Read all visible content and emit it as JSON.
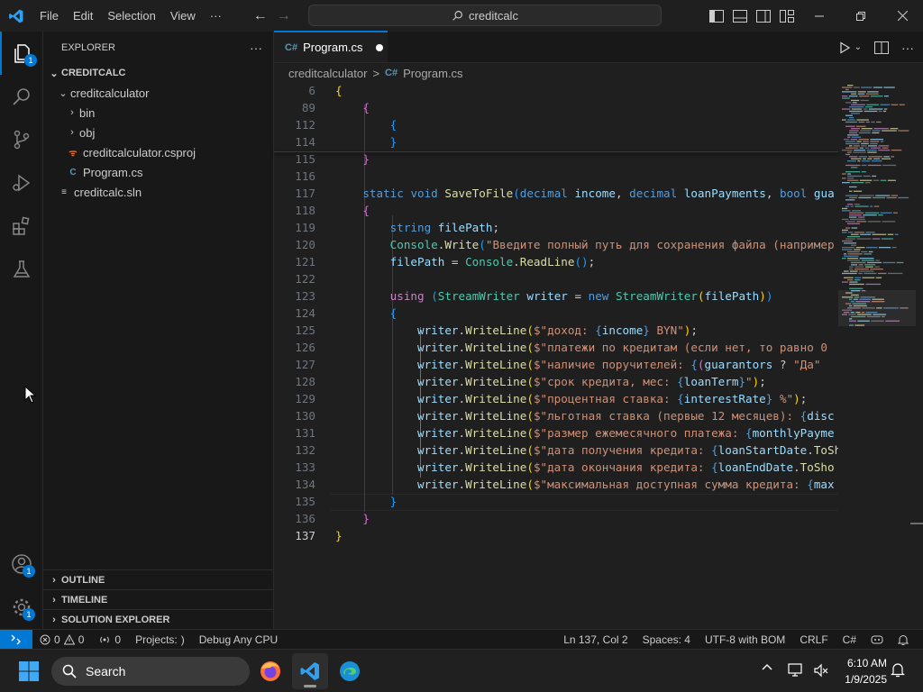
{
  "titlebar": {
    "menu": [
      "File",
      "Edit",
      "Selection",
      "View",
      "···"
    ],
    "search_text": "creditcalc"
  },
  "activity": {
    "explorer_badge": "1",
    "accounts_badge": "1",
    "manage_badge": "1"
  },
  "sidebar": {
    "header": "EXPLORER",
    "more": "···",
    "root": "CREDITCALC",
    "tree": [
      {
        "label": "creditcalculator",
        "kind": "folder-open",
        "depth": 1
      },
      {
        "label": "bin",
        "kind": "folder",
        "depth": 2
      },
      {
        "label": "obj",
        "kind": "folder",
        "depth": 2
      },
      {
        "label": "creditcalculator.csproj",
        "kind": "csproj",
        "depth": 2
      },
      {
        "label": "Program.cs",
        "kind": "cs",
        "depth": 2
      },
      {
        "label": "creditcalc.sln",
        "kind": "sln",
        "depth": 1
      }
    ],
    "panels": [
      "OUTLINE",
      "TIMELINE",
      "SOLUTION EXPLORER"
    ]
  },
  "editor": {
    "tab_label": "Program.cs",
    "tab_icon": "C#",
    "breadcrumb": [
      "creditcalculator",
      "Program.cs"
    ],
    "breadcrumb_sep": ">",
    "lines": [
      {
        "n": "6",
        "t": [
          [
            "b1",
            "{"
          ]
        ]
      },
      {
        "n": "89",
        "t": [
          [
            "pl",
            "    "
          ],
          [
            "b2",
            "{"
          ]
        ]
      },
      {
        "n": "112",
        "t": [
          [
            "pl",
            "        "
          ],
          [
            "b3",
            "{"
          ]
        ]
      },
      {
        "n": "114",
        "t": [
          [
            "pl",
            "        "
          ],
          [
            "b3",
            "}"
          ]
        ]
      },
      {
        "n": "115",
        "t": [
          [
            "pl",
            "    "
          ],
          [
            "b2",
            "}"
          ]
        ]
      },
      {
        "n": "116",
        "t": []
      },
      {
        "n": "117",
        "t": [
          [
            "pl",
            "    "
          ],
          [
            "kw",
            "static"
          ],
          [
            "pl",
            " "
          ],
          [
            "kw",
            "void"
          ],
          [
            "pl",
            " "
          ],
          [
            "fn",
            "SaveToFile"
          ],
          [
            "b3",
            "("
          ],
          [
            "kw",
            "decimal"
          ],
          [
            "pl",
            " "
          ],
          [
            "var",
            "income"
          ],
          [
            "pl",
            ", "
          ],
          [
            "kw",
            "decimal"
          ],
          [
            "pl",
            " "
          ],
          [
            "var",
            "loanPayments"
          ],
          [
            "pl",
            ", "
          ],
          [
            "kw",
            "bool"
          ],
          [
            "pl",
            " "
          ],
          [
            "var",
            "gua"
          ]
        ]
      },
      {
        "n": "118",
        "t": [
          [
            "pl",
            "    "
          ],
          [
            "b2",
            "{"
          ]
        ]
      },
      {
        "n": "119",
        "t": [
          [
            "pl",
            "        "
          ],
          [
            "kw",
            "string"
          ],
          [
            "pl",
            " "
          ],
          [
            "var",
            "filePath"
          ],
          [
            "pl",
            ";"
          ]
        ]
      },
      {
        "n": "120",
        "t": [
          [
            "pl",
            "        "
          ],
          [
            "ty",
            "Console"
          ],
          [
            "pl",
            "."
          ],
          [
            "fn",
            "Write"
          ],
          [
            "b3",
            "("
          ],
          [
            "str",
            "\"Введите полный путь для сохранения файла (например"
          ]
        ]
      },
      {
        "n": "121",
        "t": [
          [
            "pl",
            "        "
          ],
          [
            "var",
            "filePath"
          ],
          [
            "pl",
            " = "
          ],
          [
            "ty",
            "Console"
          ],
          [
            "pl",
            "."
          ],
          [
            "fn",
            "ReadLine"
          ],
          [
            "b3",
            "()"
          ],
          [
            "pl",
            ";"
          ]
        ]
      },
      {
        "n": "122",
        "t": []
      },
      {
        "n": "123",
        "t": [
          [
            "pl",
            "        "
          ],
          [
            "ctl",
            "using"
          ],
          [
            "pl",
            " "
          ],
          [
            "b3",
            "("
          ],
          [
            "ty",
            "StreamWriter"
          ],
          [
            "pl",
            " "
          ],
          [
            "var",
            "writer"
          ],
          [
            "pl",
            " = "
          ],
          [
            "kw",
            "new"
          ],
          [
            "pl",
            " "
          ],
          [
            "ty",
            "StreamWriter"
          ],
          [
            "b1",
            "("
          ],
          [
            "var",
            "filePath"
          ],
          [
            "b1",
            ")"
          ],
          [
            "b3",
            ")"
          ]
        ]
      },
      {
        "n": "124",
        "t": [
          [
            "pl",
            "        "
          ],
          [
            "b3",
            "{"
          ]
        ]
      },
      {
        "n": "125",
        "t": [
          [
            "pl",
            "            "
          ],
          [
            "var",
            "writer"
          ],
          [
            "pl",
            "."
          ],
          [
            "fn",
            "WriteLine"
          ],
          [
            "b1",
            "("
          ],
          [
            "str",
            "$\"доход: "
          ],
          [
            "kw",
            "{"
          ],
          [
            "var",
            "income"
          ],
          [
            "kw",
            "}"
          ],
          [
            "str",
            " BYN\""
          ],
          [
            "b1",
            ")"
          ],
          [
            "pl",
            ";"
          ]
        ]
      },
      {
        "n": "126",
        "t": [
          [
            "pl",
            "            "
          ],
          [
            "var",
            "writer"
          ],
          [
            "pl",
            "."
          ],
          [
            "fn",
            "WriteLine"
          ],
          [
            "b1",
            "("
          ],
          [
            "str",
            "$\"платежи по кредитам (если нет, то равно 0"
          ]
        ]
      },
      {
        "n": "127",
        "t": [
          [
            "pl",
            "            "
          ],
          [
            "var",
            "writer"
          ],
          [
            "pl",
            "."
          ],
          [
            "fn",
            "WriteLine"
          ],
          [
            "b1",
            "("
          ],
          [
            "str",
            "$\"наличие поручителей: "
          ],
          [
            "kw",
            "{"
          ],
          [
            "b2",
            "("
          ],
          [
            "var",
            "guarantors"
          ],
          [
            "pl",
            " ? "
          ],
          [
            "str",
            "\"Да\""
          ]
        ]
      },
      {
        "n": "128",
        "t": [
          [
            "pl",
            "            "
          ],
          [
            "var",
            "writer"
          ],
          [
            "pl",
            "."
          ],
          [
            "fn",
            "WriteLine"
          ],
          [
            "b1",
            "("
          ],
          [
            "str",
            "$\"срок кредита, мес: "
          ],
          [
            "kw",
            "{"
          ],
          [
            "var",
            "loanTerm"
          ],
          [
            "kw",
            "}"
          ],
          [
            "str",
            "\""
          ],
          [
            "b1",
            ")"
          ],
          [
            "pl",
            ";"
          ]
        ]
      },
      {
        "n": "129",
        "t": [
          [
            "pl",
            "            "
          ],
          [
            "var",
            "writer"
          ],
          [
            "pl",
            "."
          ],
          [
            "fn",
            "WriteLine"
          ],
          [
            "b1",
            "("
          ],
          [
            "str",
            "$\"процентная ставка: "
          ],
          [
            "kw",
            "{"
          ],
          [
            "var",
            "interestRate"
          ],
          [
            "kw",
            "}"
          ],
          [
            "str",
            " %\""
          ],
          [
            "b1",
            ")"
          ],
          [
            "pl",
            ";"
          ]
        ]
      },
      {
        "n": "130",
        "t": [
          [
            "pl",
            "            "
          ],
          [
            "var",
            "writer"
          ],
          [
            "pl",
            "."
          ],
          [
            "fn",
            "WriteLine"
          ],
          [
            "b1",
            "("
          ],
          [
            "str",
            "$\"льготная ставка (первые 12 месяцев): "
          ],
          [
            "kw",
            "{"
          ],
          [
            "var",
            "disc"
          ]
        ]
      },
      {
        "n": "131",
        "t": [
          [
            "pl",
            "            "
          ],
          [
            "var",
            "writer"
          ],
          [
            "pl",
            "."
          ],
          [
            "fn",
            "WriteLine"
          ],
          [
            "b1",
            "("
          ],
          [
            "str",
            "$\"размер ежемесячного платежа: "
          ],
          [
            "kw",
            "{"
          ],
          [
            "var",
            "monthlyPayme"
          ]
        ]
      },
      {
        "n": "132",
        "t": [
          [
            "pl",
            "            "
          ],
          [
            "var",
            "writer"
          ],
          [
            "pl",
            "."
          ],
          [
            "fn",
            "WriteLine"
          ],
          [
            "b1",
            "("
          ],
          [
            "str",
            "$\"дата получения кредита: "
          ],
          [
            "kw",
            "{"
          ],
          [
            "var",
            "loanStartDate"
          ],
          [
            "pl",
            "."
          ],
          [
            "fn",
            "ToSh"
          ]
        ]
      },
      {
        "n": "133",
        "t": [
          [
            "pl",
            "            "
          ],
          [
            "var",
            "writer"
          ],
          [
            "pl",
            "."
          ],
          [
            "fn",
            "WriteLine"
          ],
          [
            "b1",
            "("
          ],
          [
            "str",
            "$\"дата окончания кредита: "
          ],
          [
            "kw",
            "{"
          ],
          [
            "var",
            "loanEndDate"
          ],
          [
            "pl",
            "."
          ],
          [
            "fn",
            "ToSho"
          ]
        ]
      },
      {
        "n": "134",
        "t": [
          [
            "pl",
            "            "
          ],
          [
            "var",
            "writer"
          ],
          [
            "pl",
            "."
          ],
          [
            "fn",
            "WriteLine"
          ],
          [
            "b1",
            "("
          ],
          [
            "str",
            "$\"максимальная доступная сумма кредита: "
          ],
          [
            "kw",
            "{"
          ],
          [
            "var",
            "max"
          ]
        ]
      },
      {
        "n": "135",
        "t": [
          [
            "pl",
            "        "
          ],
          [
            "b3",
            "}"
          ]
        ]
      },
      {
        "n": "136",
        "t": [
          [
            "pl",
            "    "
          ],
          [
            "b2",
            "}"
          ]
        ]
      },
      {
        "n": "137",
        "t": [
          [
            "b1",
            "}"
          ]
        ]
      }
    ]
  },
  "statusbar": {
    "errors": "0",
    "warnings": "0",
    "ports": "0",
    "projects": "Projects:",
    "debug": "Debug Any CPU",
    "position": "Ln 137, Col 2",
    "spaces": "Spaces: 4",
    "encoding": "UTF-8 with BOM",
    "eol": "CRLF",
    "language": "C#"
  },
  "taskbar": {
    "search": "Search",
    "time": "6:10 AM",
    "date": "1/9/2025"
  },
  "colors": {
    "accent": "#0078d4",
    "editor_bg": "#1f1f1f",
    "sidebar_bg": "#181818",
    "keyword": "#569cd6",
    "type": "#4ec9b0",
    "method": "#dcdcaa",
    "variable": "#9cdcfe",
    "string": "#ce9178"
  }
}
